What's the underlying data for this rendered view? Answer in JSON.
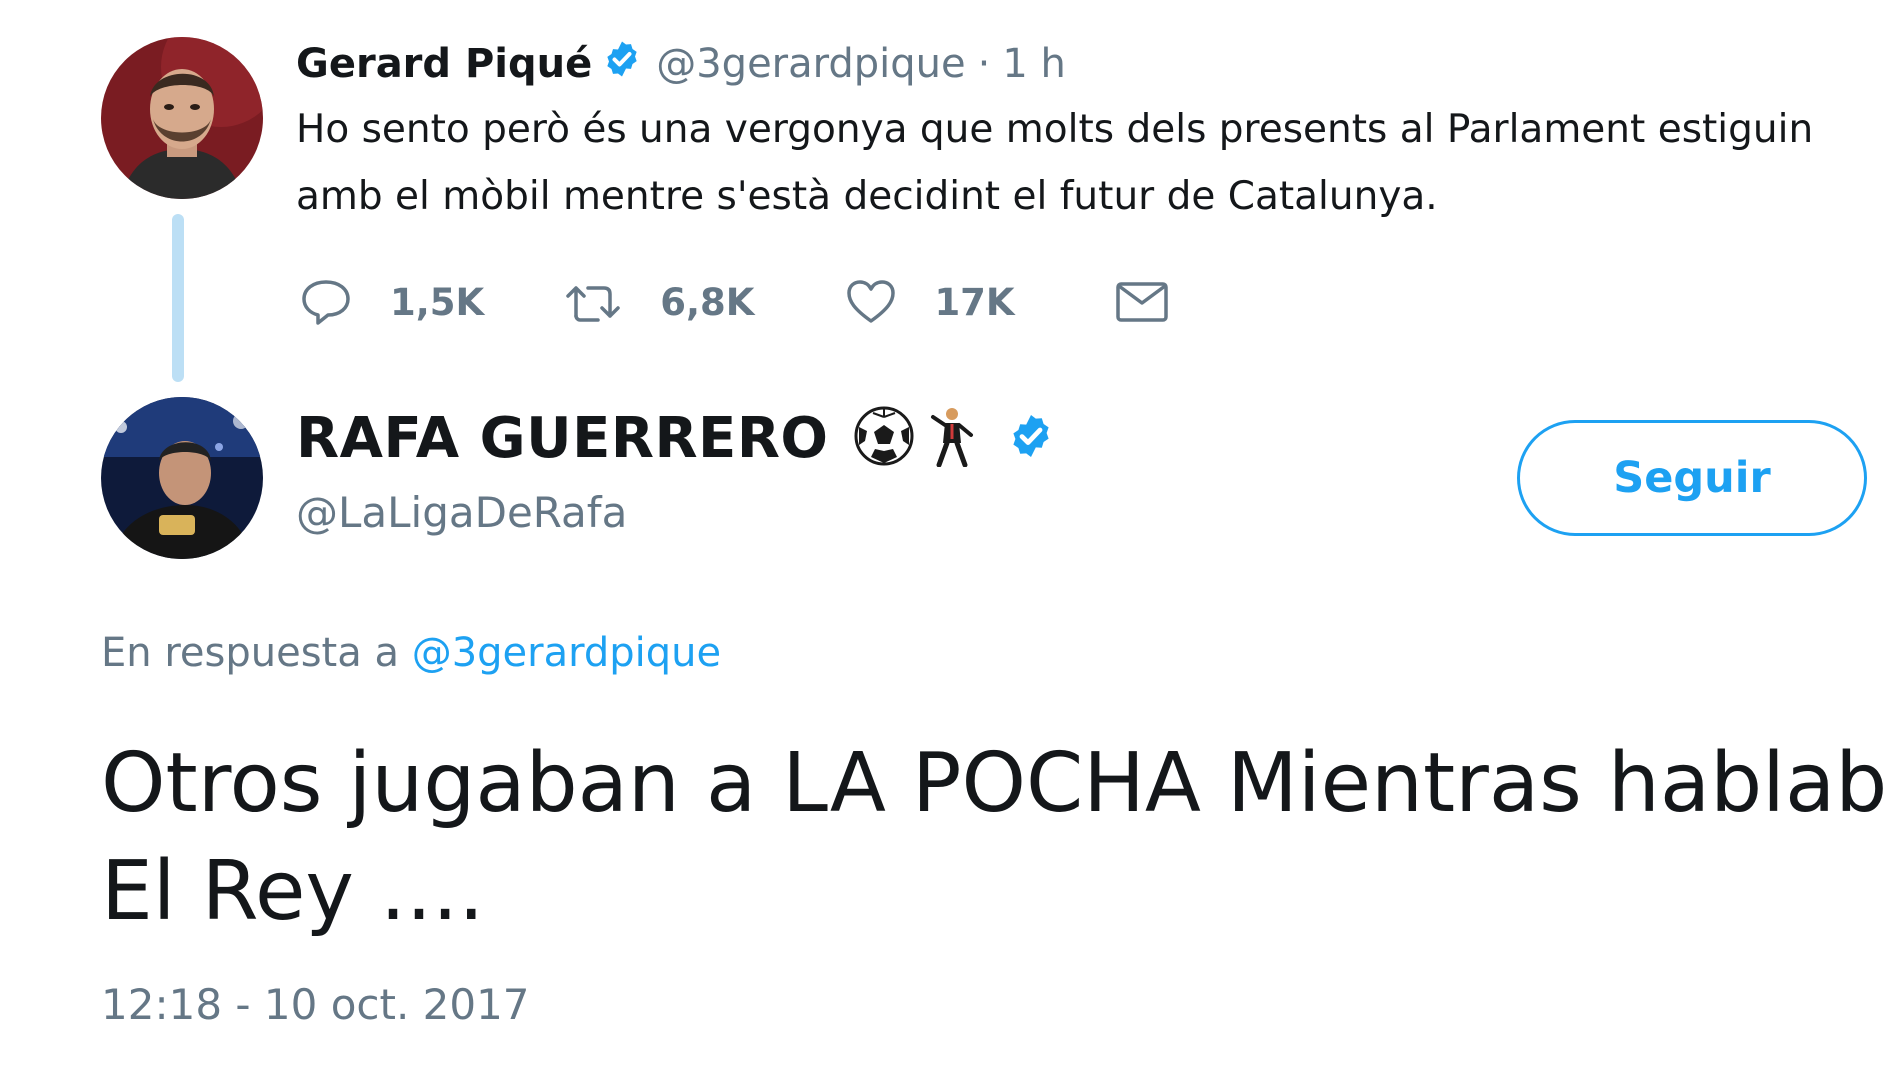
{
  "colors": {
    "accent": "#1da1f2",
    "secondary_text": "#657786",
    "primary_text": "#14171a",
    "thread_line": "#bcdff5"
  },
  "tweet1": {
    "author_name": "Gerard Piqué",
    "handle": "@3gerardpique",
    "separator": "·",
    "time": "1 h",
    "verified_icon": "verified-badge-icon",
    "text": "Ho sento però és una vergonya que molts dels presents al Parlament estiguin amb el mòbil mentre s'està decidint el futur de Catalunya.",
    "actions": {
      "reply": {
        "icon": "reply-icon",
        "count": "1,5K"
      },
      "retweet": {
        "icon": "retweet-icon",
        "count": "6,8K"
      },
      "like": {
        "icon": "heart-icon",
        "count": "17K"
      },
      "message": {
        "icon": "mail-icon"
      }
    }
  },
  "tweet2": {
    "author_name": "RAFA GUERRERO",
    "name_emojis": [
      "soccer-ball-emoji",
      "man-dancing-emoji"
    ],
    "verified_icon": "verified-badge-icon",
    "handle": "@LaLigaDeRafa",
    "follow_label": "Seguir",
    "reply_prefix": "En respuesta a",
    "reply_to": "@3gerardpique",
    "text_line1": "Otros jugaban a LA POCHA Mientras hablab",
    "text_line2": "El Rey ....",
    "timestamp": "12:18 - 10 oct. 2017"
  }
}
